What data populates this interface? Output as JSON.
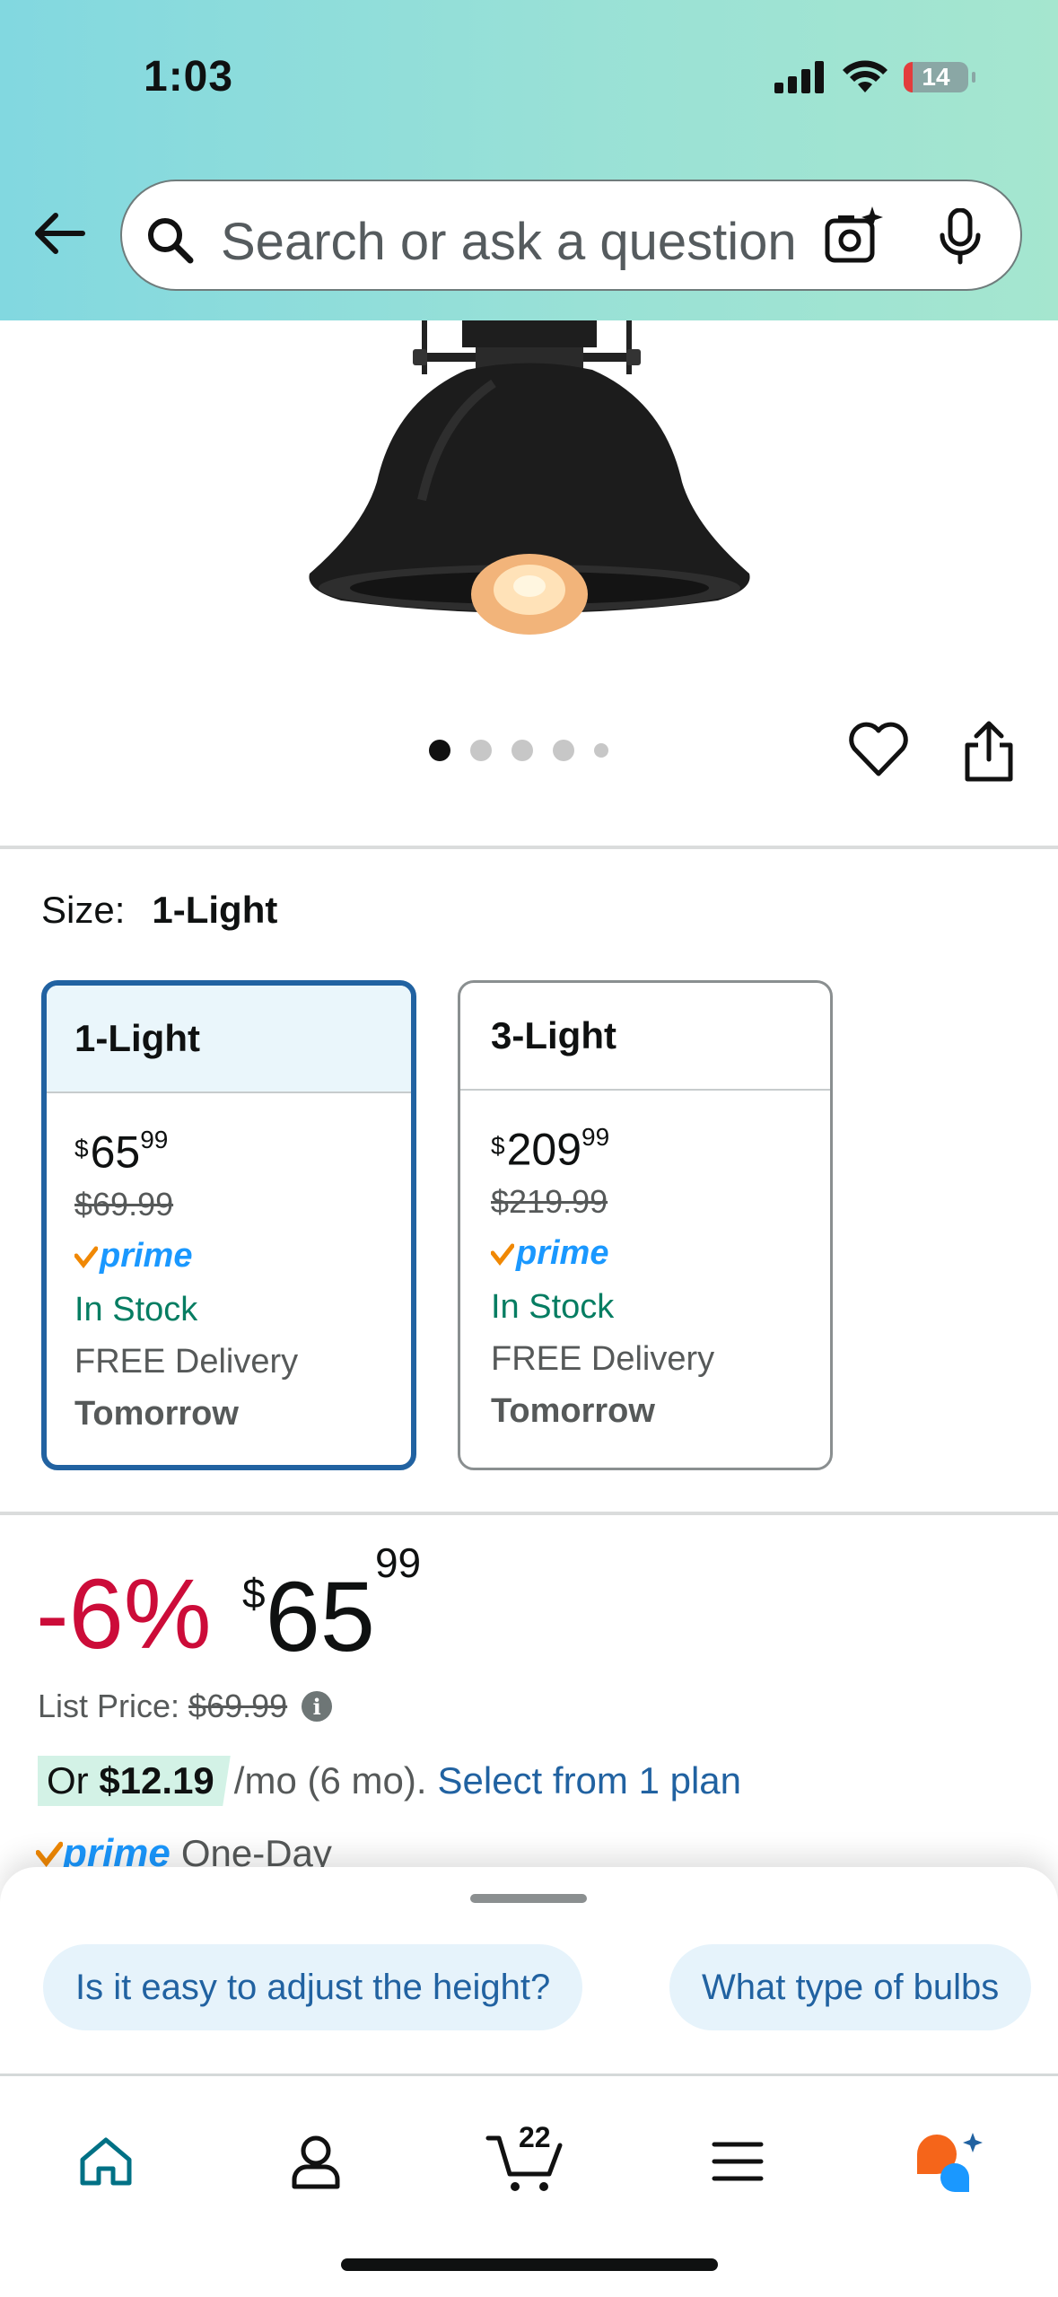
{
  "status_bar": {
    "time": "1:03",
    "battery": "14"
  },
  "search": {
    "placeholder": "Search or ask a question"
  },
  "gallery": {
    "image_count": 5,
    "active_index": 0
  },
  "size": {
    "label": "Size:",
    "selected": "1-Light",
    "options": [
      {
        "name": "1-Light",
        "currency": "$",
        "price_whole": "65",
        "price_fraction": "99",
        "was": "$69.99",
        "prime": "prime",
        "stock": "In Stock",
        "delivery": "FREE Delivery",
        "delivery_day": "Tomorrow",
        "selected": true
      },
      {
        "name": "3-Light",
        "currency": "$",
        "price_whole": "209",
        "price_fraction": "99",
        "was": "$219.99",
        "prime": "prime",
        "stock": "In Stock",
        "delivery": "FREE Delivery",
        "delivery_day": "Tomorrow",
        "selected": false
      }
    ]
  },
  "price_block": {
    "discount": "-6%",
    "currency": "$",
    "whole": "65",
    "fraction": "99",
    "list_price_label": "List Price:",
    "list_price": "$69.99",
    "monthly_prefix": "Or",
    "monthly_amount": "$12.19",
    "monthly_terms": "/mo (6 mo).",
    "monthly_link": "Select from 1 plan",
    "prime_label": "prime",
    "one_day": "One-Day"
  },
  "questions": [
    "Is it easy to adjust the height?",
    "What type of bulbs"
  ],
  "nav": {
    "cart_count": "22"
  },
  "colors": {
    "accent_blue": "#2162a1",
    "deal_red": "#cc0c39",
    "stock_green": "#067d62",
    "prime_blue": "#1a98ff",
    "prime_check": "#f08804"
  }
}
